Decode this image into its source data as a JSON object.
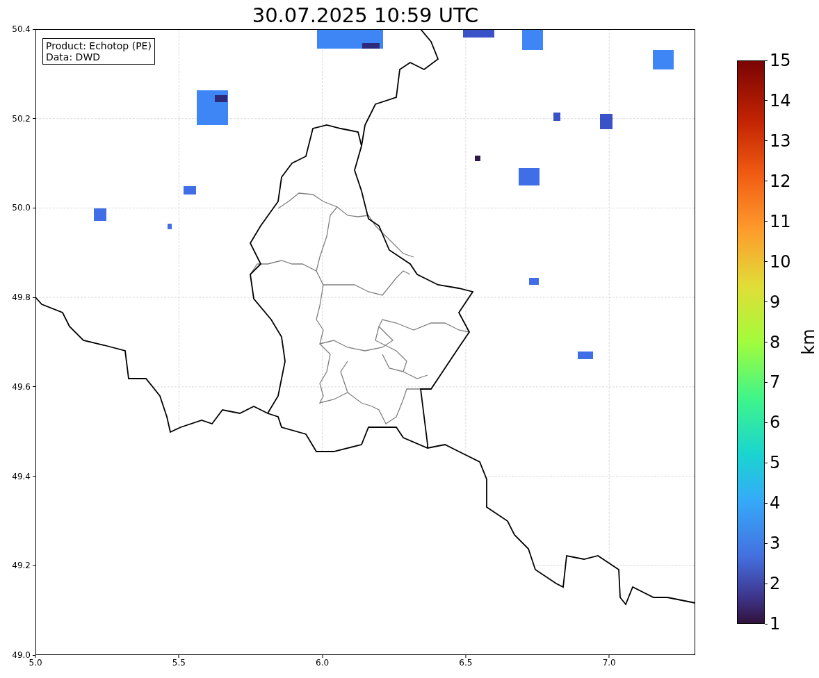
{
  "title": "30.07.2025 10:59 UTC",
  "info_box": {
    "lines": [
      "Product: Echotop (PE)",
      "Data: DWD"
    ]
  },
  "x_axis": {
    "ticks": [
      "5.0",
      "5.5",
      "6.0",
      "6.5",
      "7.0"
    ]
  },
  "y_axis": {
    "ticks": [
      "50.4",
      "50.2",
      "50.0",
      "49.8",
      "49.6",
      "49.4",
      "49.2",
      "49.0"
    ]
  },
  "colorbar": {
    "label": "km",
    "ticks": [
      "15",
      "14",
      "13",
      "12",
      "11",
      "10",
      "9",
      "8",
      "7",
      "6",
      "5",
      "4",
      "3",
      "2",
      "1"
    ]
  }
}
